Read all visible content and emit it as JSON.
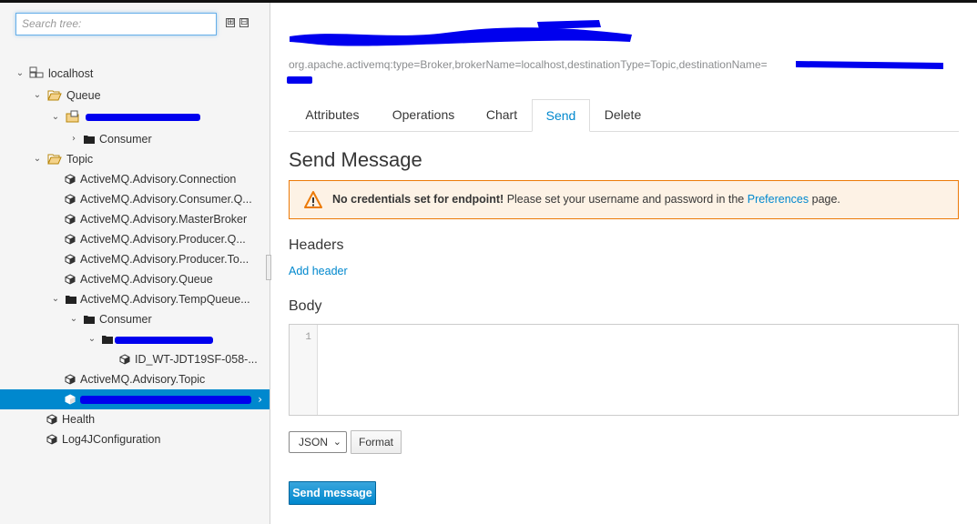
{
  "search": {
    "placeholder": "Search tree:"
  },
  "tree_controls": {
    "expand": "⊞",
    "collapse": "⊟"
  },
  "tree": {
    "localhost": "localhost",
    "queue": "Queue",
    "queue_consumer": "Consumer",
    "topic": "Topic",
    "topics": [
      "ActiveMQ.Advisory.Connection",
      "ActiveMQ.Advisory.Consumer.Q...",
      "ActiveMQ.Advisory.MasterBroker",
      "ActiveMQ.Advisory.Producer.Q...",
      "ActiveMQ.Advisory.Producer.To...",
      "ActiveMQ.Advisory.Queue",
      "ActiveMQ.Advisory.TempQueue..."
    ],
    "temp_consumer": "Consumer",
    "consumer_id": "ID_WT-JDT19SF-058-...",
    "advisory_topic": "ActiveMQ.Advisory.Topic",
    "health": "Health",
    "log4j": "Log4JConfiguration"
  },
  "mbean": {
    "object_name": "org.apache.activemq:type=Broker,brokerName=localhost,destinationType=Topic,destinationName="
  },
  "tabs": [
    "Attributes",
    "Operations",
    "Chart",
    "Send",
    "Delete"
  ],
  "active_tab": "Send",
  "page_title": "Send Message",
  "alert": {
    "strong": "No credentials set for endpoint!",
    "text": " Please set your username and password in the ",
    "link": "Preferences",
    "suffix": " page."
  },
  "headers": {
    "title": "Headers",
    "add_link": "Add header"
  },
  "body": {
    "title": "Body",
    "line_number": "1"
  },
  "format": {
    "selected": "JSON",
    "button": "Format"
  },
  "send_button": "Send message",
  "colors": {
    "accent": "#0088ce",
    "warning": "#ec7a08",
    "redaction": "#0000ee"
  }
}
